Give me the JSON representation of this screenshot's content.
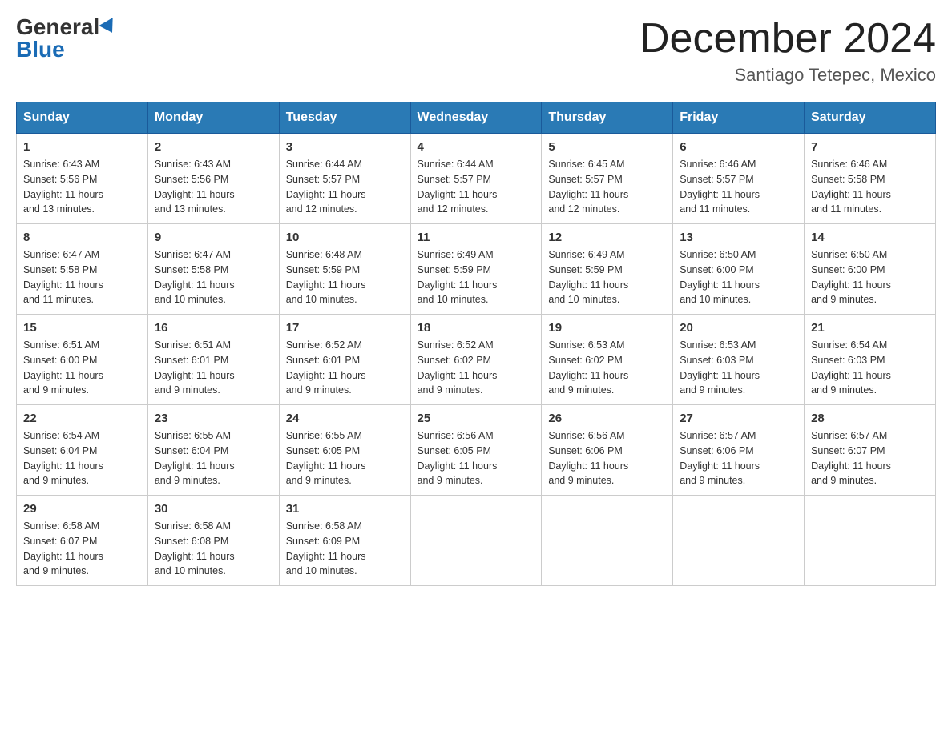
{
  "header": {
    "logo_general": "General",
    "logo_blue": "Blue",
    "month_title": "December 2024",
    "location": "Santiago Tetepec, Mexico"
  },
  "days_of_week": [
    "Sunday",
    "Monday",
    "Tuesday",
    "Wednesday",
    "Thursday",
    "Friday",
    "Saturday"
  ],
  "weeks": [
    [
      {
        "day": "1",
        "sunrise": "6:43 AM",
        "sunset": "5:56 PM",
        "daylight": "11 hours and 13 minutes."
      },
      {
        "day": "2",
        "sunrise": "6:43 AM",
        "sunset": "5:56 PM",
        "daylight": "11 hours and 13 minutes."
      },
      {
        "day": "3",
        "sunrise": "6:44 AM",
        "sunset": "5:57 PM",
        "daylight": "11 hours and 12 minutes."
      },
      {
        "day": "4",
        "sunrise": "6:44 AM",
        "sunset": "5:57 PM",
        "daylight": "11 hours and 12 minutes."
      },
      {
        "day": "5",
        "sunrise": "6:45 AM",
        "sunset": "5:57 PM",
        "daylight": "11 hours and 12 minutes."
      },
      {
        "day": "6",
        "sunrise": "6:46 AM",
        "sunset": "5:57 PM",
        "daylight": "11 hours and 11 minutes."
      },
      {
        "day": "7",
        "sunrise": "6:46 AM",
        "sunset": "5:58 PM",
        "daylight": "11 hours and 11 minutes."
      }
    ],
    [
      {
        "day": "8",
        "sunrise": "6:47 AM",
        "sunset": "5:58 PM",
        "daylight": "11 hours and 11 minutes."
      },
      {
        "day": "9",
        "sunrise": "6:47 AM",
        "sunset": "5:58 PM",
        "daylight": "11 hours and 10 minutes."
      },
      {
        "day": "10",
        "sunrise": "6:48 AM",
        "sunset": "5:59 PM",
        "daylight": "11 hours and 10 minutes."
      },
      {
        "day": "11",
        "sunrise": "6:49 AM",
        "sunset": "5:59 PM",
        "daylight": "11 hours and 10 minutes."
      },
      {
        "day": "12",
        "sunrise": "6:49 AM",
        "sunset": "5:59 PM",
        "daylight": "11 hours and 10 minutes."
      },
      {
        "day": "13",
        "sunrise": "6:50 AM",
        "sunset": "6:00 PM",
        "daylight": "11 hours and 10 minutes."
      },
      {
        "day": "14",
        "sunrise": "6:50 AM",
        "sunset": "6:00 PM",
        "daylight": "11 hours and 9 minutes."
      }
    ],
    [
      {
        "day": "15",
        "sunrise": "6:51 AM",
        "sunset": "6:00 PM",
        "daylight": "11 hours and 9 minutes."
      },
      {
        "day": "16",
        "sunrise": "6:51 AM",
        "sunset": "6:01 PM",
        "daylight": "11 hours and 9 minutes."
      },
      {
        "day": "17",
        "sunrise": "6:52 AM",
        "sunset": "6:01 PM",
        "daylight": "11 hours and 9 minutes."
      },
      {
        "day": "18",
        "sunrise": "6:52 AM",
        "sunset": "6:02 PM",
        "daylight": "11 hours and 9 minutes."
      },
      {
        "day": "19",
        "sunrise": "6:53 AM",
        "sunset": "6:02 PM",
        "daylight": "11 hours and 9 minutes."
      },
      {
        "day": "20",
        "sunrise": "6:53 AM",
        "sunset": "6:03 PM",
        "daylight": "11 hours and 9 minutes."
      },
      {
        "day": "21",
        "sunrise": "6:54 AM",
        "sunset": "6:03 PM",
        "daylight": "11 hours and 9 minutes."
      }
    ],
    [
      {
        "day": "22",
        "sunrise": "6:54 AM",
        "sunset": "6:04 PM",
        "daylight": "11 hours and 9 minutes."
      },
      {
        "day": "23",
        "sunrise": "6:55 AM",
        "sunset": "6:04 PM",
        "daylight": "11 hours and 9 minutes."
      },
      {
        "day": "24",
        "sunrise": "6:55 AM",
        "sunset": "6:05 PM",
        "daylight": "11 hours and 9 minutes."
      },
      {
        "day": "25",
        "sunrise": "6:56 AM",
        "sunset": "6:05 PM",
        "daylight": "11 hours and 9 minutes."
      },
      {
        "day": "26",
        "sunrise": "6:56 AM",
        "sunset": "6:06 PM",
        "daylight": "11 hours and 9 minutes."
      },
      {
        "day": "27",
        "sunrise": "6:57 AM",
        "sunset": "6:06 PM",
        "daylight": "11 hours and 9 minutes."
      },
      {
        "day": "28",
        "sunrise": "6:57 AM",
        "sunset": "6:07 PM",
        "daylight": "11 hours and 9 minutes."
      }
    ],
    [
      {
        "day": "29",
        "sunrise": "6:58 AM",
        "sunset": "6:07 PM",
        "daylight": "11 hours and 9 minutes."
      },
      {
        "day": "30",
        "sunrise": "6:58 AM",
        "sunset": "6:08 PM",
        "daylight": "11 hours and 10 minutes."
      },
      {
        "day": "31",
        "sunrise": "6:58 AM",
        "sunset": "6:09 PM",
        "daylight": "11 hours and 10 minutes."
      },
      null,
      null,
      null,
      null
    ]
  ],
  "labels": {
    "sunrise": "Sunrise:",
    "sunset": "Sunset:",
    "daylight": "Daylight:"
  }
}
